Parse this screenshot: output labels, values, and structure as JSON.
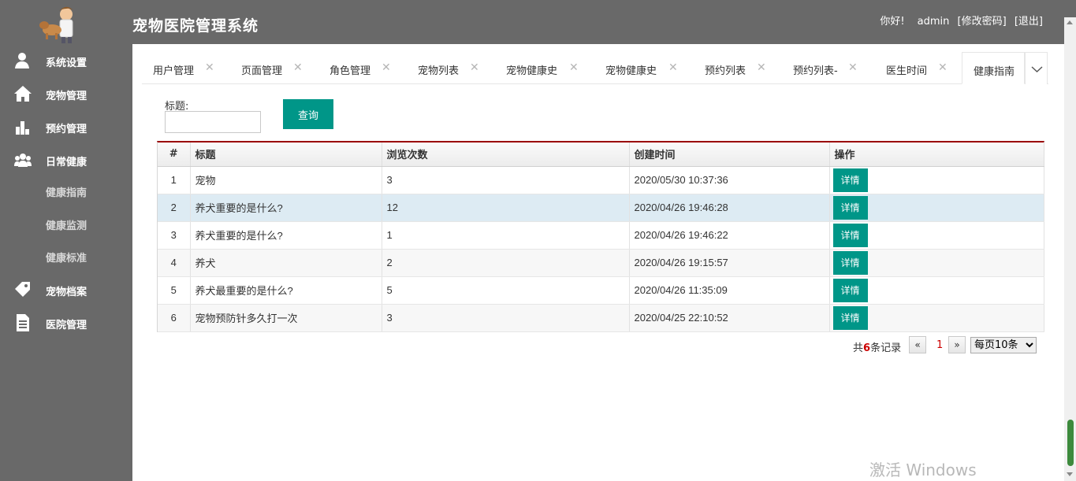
{
  "header": {
    "app_title": "宠物医院管理系统",
    "greeting": "你好!",
    "username": "admin",
    "change_password": "[修改密码]",
    "logout": "[退出]"
  },
  "sidebar": {
    "items": [
      {
        "label": "系统设置",
        "icon": "user-gear-icon"
      },
      {
        "label": "宠物管理",
        "icon": "home-icon"
      },
      {
        "label": "预约管理",
        "icon": "bar-chart-icon"
      },
      {
        "label": "日常健康",
        "icon": "users-icon"
      },
      {
        "label": "宠物档案",
        "icon": "tag-icon"
      },
      {
        "label": "医院管理",
        "icon": "document-icon"
      }
    ],
    "sub_items": [
      "健康指南",
      "健康监测",
      "健康标准"
    ]
  },
  "tabs": [
    {
      "label": "用户管理"
    },
    {
      "label": "页面管理"
    },
    {
      "label": "角色管理"
    },
    {
      "label": "宠物列表"
    },
    {
      "label": "宠物健康史"
    },
    {
      "label": "宠物健康史"
    },
    {
      "label": "预约列表"
    },
    {
      "label": "预约列表-"
    },
    {
      "label": "医生时间"
    },
    {
      "label": "健康指南"
    }
  ],
  "active_tab": "健康指南",
  "search": {
    "label": "标题:",
    "value": "",
    "button": "查询"
  },
  "table": {
    "columns": [
      "#",
      "标题",
      "浏览次数",
      "创建时间",
      "操作"
    ],
    "rows": [
      {
        "num": "1",
        "title": "宠物",
        "views": "3",
        "created": "2020/05/30 10:37:36",
        "action": "详情"
      },
      {
        "num": "2",
        "title": "养犬重要的是什么?",
        "views": "12",
        "created": "2020/04/26 19:46:28",
        "action": "详情"
      },
      {
        "num": "3",
        "title": "养犬重要的是什么?",
        "views": "1",
        "created": "2020/04/26 19:46:22",
        "action": "详情"
      },
      {
        "num": "4",
        "title": "养犬",
        "views": "2",
        "created": "2020/04/26 19:15:57",
        "action": "详情"
      },
      {
        "num": "5",
        "title": "养犬最重要的是什么?",
        "views": "5",
        "created": "2020/04/26 11:35:09",
        "action": "详情"
      },
      {
        "num": "6",
        "title": "宠物预防针多久打一次",
        "views": "3",
        "created": "2020/04/25 22:10:52",
        "action": "详情"
      }
    ]
  },
  "pager": {
    "total_prefix": "共",
    "total": "6",
    "total_suffix": "条记录",
    "prev": "«",
    "current_page": "1",
    "next": "»",
    "page_size": "每页10条"
  },
  "watermark": "激活 Windows",
  "colors": {
    "header_bg": "#696969",
    "accent": "#009688",
    "grid_top_border": "#9a0000",
    "selected_row": "#ddebf3"
  }
}
